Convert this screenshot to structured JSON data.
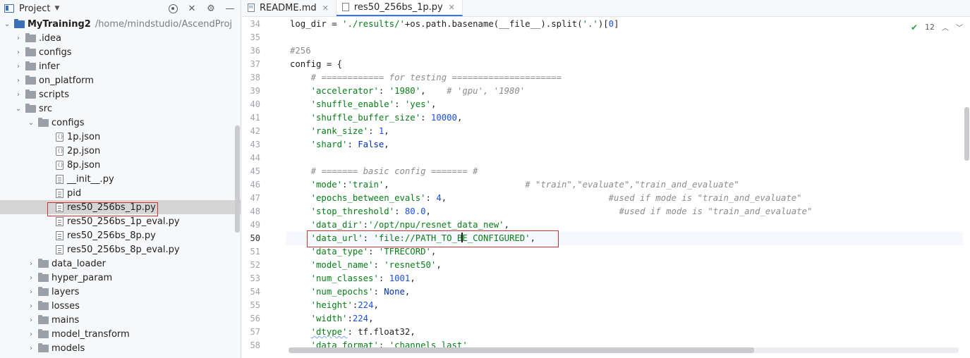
{
  "panel": {
    "title": "Project",
    "dropdown_icon": "chevron-down-icon",
    "tools": [
      "locate-icon",
      "collapse-icon",
      "gear-icon",
      "minimize-icon"
    ]
  },
  "tree": {
    "root_name": "MyTraining2",
    "root_path": "/home/mindstudio/AscendProj",
    "items": [
      {
        "label": ".idea"
      },
      {
        "label": "configs"
      },
      {
        "label": "infer"
      },
      {
        "label": "on_platform"
      },
      {
        "label": "scripts"
      },
      {
        "label": "src"
      },
      {
        "label": "configs"
      },
      {
        "label": "1p.json"
      },
      {
        "label": "2p.json"
      },
      {
        "label": "8p.json"
      },
      {
        "label": "__init__.py"
      },
      {
        "label": "pid"
      },
      {
        "label": "res50_256bs_1p.py"
      },
      {
        "label": "res50_256bs_1p_eval.py"
      },
      {
        "label": "res50_256bs_8p.py"
      },
      {
        "label": "res50_256bs_8p_eval.py"
      },
      {
        "label": "data_loader"
      },
      {
        "label": "hyper_param"
      },
      {
        "label": "layers"
      },
      {
        "label": "losses"
      },
      {
        "label": "mains"
      },
      {
        "label": "model_transform"
      },
      {
        "label": "models"
      }
    ]
  },
  "tabs": [
    {
      "label": "README.md",
      "close": "✕"
    },
    {
      "label": "res50_256bs_1p.py",
      "close": "✕"
    }
  ],
  "inspection": {
    "count": "12"
  },
  "code_lines": [
    {
      "num": "34"
    },
    {
      "num": "35"
    },
    {
      "num": "36"
    },
    {
      "num": "37"
    },
    {
      "num": "38"
    },
    {
      "num": "39"
    },
    {
      "num": "40"
    },
    {
      "num": "41"
    },
    {
      "num": "42"
    },
    {
      "num": "43"
    },
    {
      "num": "44"
    },
    {
      "num": "45"
    },
    {
      "num": "46"
    },
    {
      "num": "47"
    },
    {
      "num": "48"
    },
    {
      "num": "49"
    },
    {
      "num": "50"
    },
    {
      "num": "51"
    },
    {
      "num": "52"
    },
    {
      "num": "53"
    },
    {
      "num": "54"
    },
    {
      "num": "55"
    },
    {
      "num": "56"
    },
    {
      "num": "57"
    },
    {
      "num": "58"
    }
  ],
  "code": {
    "l34": [
      "log_dir",
      " = ",
      "'./results/'",
      "+os.path.basename(",
      "__file__",
      ").split(",
      "'.'",
      ")[",
      "0",
      "]"
    ],
    "l36": "#256",
    "l37": "config = {",
    "l38": "# ============ for testing =====================",
    "l39": [
      "'accelerator'",
      ": ",
      "'1980'",
      ",    ",
      "# 'gpu', '1980'"
    ],
    "l40": [
      "'shuffle_enable'",
      ": ",
      "'yes'",
      ","
    ],
    "l41": [
      "'shuffle_buffer_size'",
      ": ",
      "10000",
      ","
    ],
    "l42": [
      "'rank_size'",
      ": ",
      "1",
      ","
    ],
    "l43": [
      "'shard'",
      ": ",
      "False",
      ","
    ],
    "l45": "# ======= basic config ======= #",
    "l46": [
      "'mode'",
      ":",
      "'train'",
      ",",
      "# \"train\",\"evaluate\",\"train_and_evaluate\""
    ],
    "l47": [
      "'epochs_between_evals'",
      ": ",
      "4",
      ",",
      "#used if mode is \"train_and_evaluate\""
    ],
    "l48": [
      "'stop_threshold'",
      ": ",
      "80.0",
      ",",
      "#used if mode is \"train_and_evaluate\""
    ],
    "l49": [
      "'data_dir'",
      ":",
      "'/opt/npu/resnet_data_new'",
      ","
    ],
    "l50": [
      "'data_url'",
      ": ",
      "'file://PATH_TO_B",
      "E_CONFIGURED'",
      ","
    ],
    "l51": [
      "'data_type'",
      ": ",
      "'TFRECORD'",
      ","
    ],
    "l52": [
      "'model_name'",
      ": ",
      "'resnet50'",
      ","
    ],
    "l53": [
      "'num_classes'",
      ": ",
      "1001",
      ","
    ],
    "l54": [
      "'num_epochs'",
      ": ",
      "None",
      ","
    ],
    "l55": [
      "'height'",
      ":",
      "224",
      ","
    ],
    "l56": [
      "'width'",
      ":",
      "224",
      ","
    ],
    "l57": [
      "'dtype'",
      ": ",
      "tf.float32",
      ","
    ],
    "l58": [
      "'data_format'",
      ": ",
      "'channels_last'"
    ]
  }
}
